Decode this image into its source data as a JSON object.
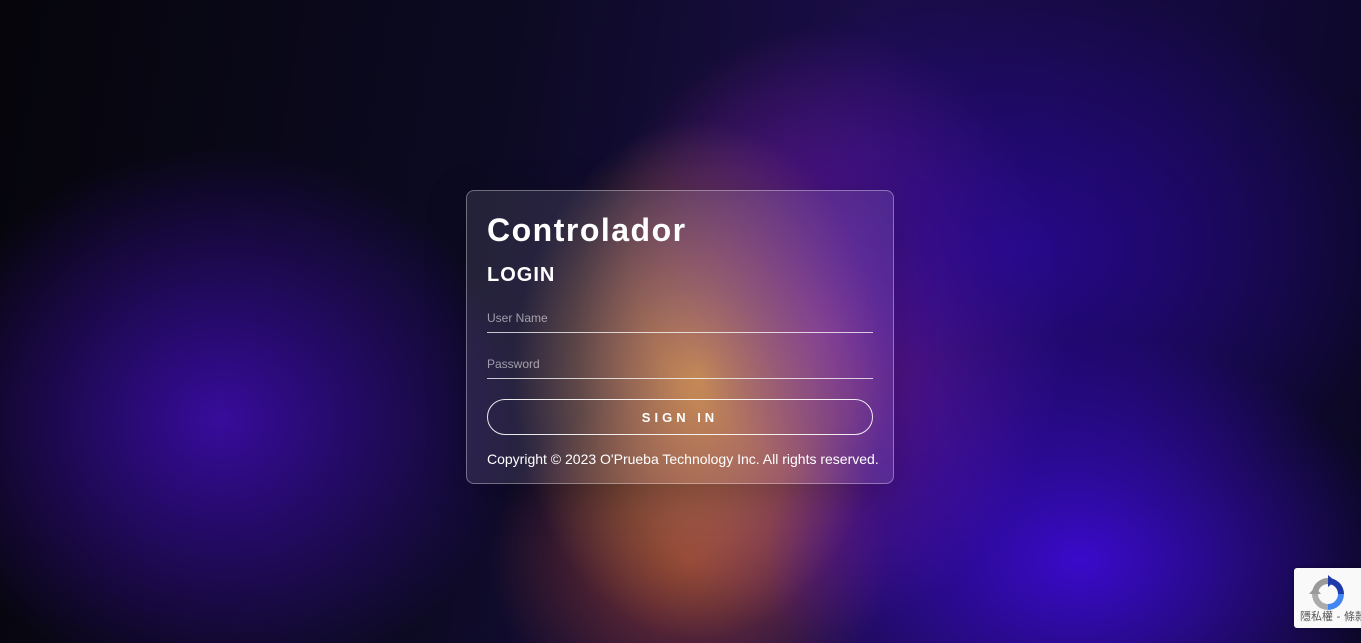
{
  "login": {
    "brand": "Controlador",
    "heading": "LOGIN",
    "username_placeholder": "User Name",
    "password_placeholder": "Password",
    "signin_label": "SIGN IN",
    "copyright": "Copyright © 2023 O'Prueba Technology Inc. All rights reserved."
  },
  "recaptcha": {
    "icon": "recaptcha-icon",
    "links_text": "隱私權 - 條款"
  },
  "colors": {
    "text": "#ffffff",
    "card_border": "#ffffff",
    "accent_purple": "#3c0ad2",
    "accent_orange": "#d28c3c"
  }
}
